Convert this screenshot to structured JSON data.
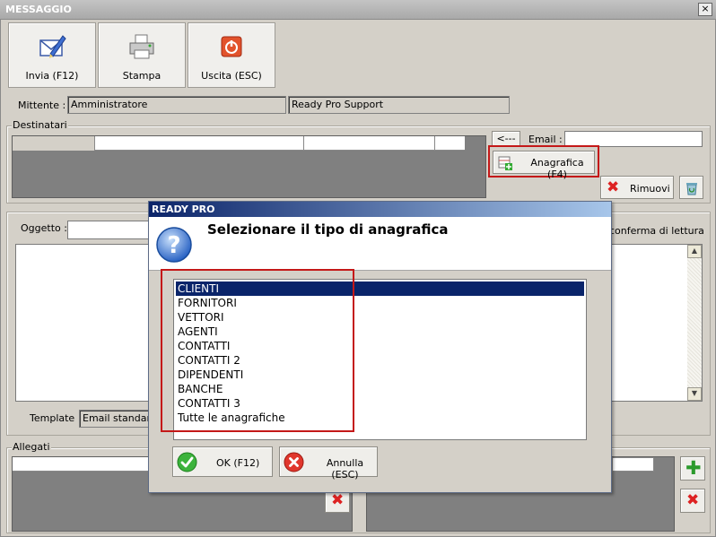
{
  "window": {
    "title": "MESSAGGIO",
    "close_glyph": "×"
  },
  "toolbar": {
    "send_label": "Invia (F12)",
    "print_label": "Stampa",
    "exit_label": "Uscita (ESC)"
  },
  "sender": {
    "label": "Mittente :",
    "name": "Amministratore",
    "account": "Ready Pro Support"
  },
  "recipients": {
    "group_label": "Destinatari",
    "arrow_label": "<---",
    "email_label": "Email :",
    "email_value": "",
    "registry_button": "Anagrafica (F4)",
    "remove_button": "Rimuovi"
  },
  "message": {
    "subject_label": "Oggetto :",
    "read_receipt_label": "conferma di lettura",
    "template_label": "Template :",
    "template_value": "Email standard"
  },
  "attachments": {
    "group_label": "Allegati"
  },
  "dialog": {
    "title": "READY PRO",
    "prompt": "Selezionare il tipo di anagrafica",
    "items": [
      "CLIENTI",
      "FORNITORI",
      "VETTORI",
      "AGENTI",
      "CONTATTI",
      "CONTATTI 2",
      "DIPENDENTI",
      "BANCHE",
      "CONTATTI 3",
      "Tutte le anagrafiche"
    ],
    "selected_index": 0,
    "ok_label": "OK (F12)",
    "cancel_label": "Annulla (ESC)"
  },
  "colors": {
    "selection": "#0a246a",
    "highlight_box": "#c41818",
    "dialog_title_start": "#0b2469",
    "dialog_title_end": "#a7c6ea"
  }
}
